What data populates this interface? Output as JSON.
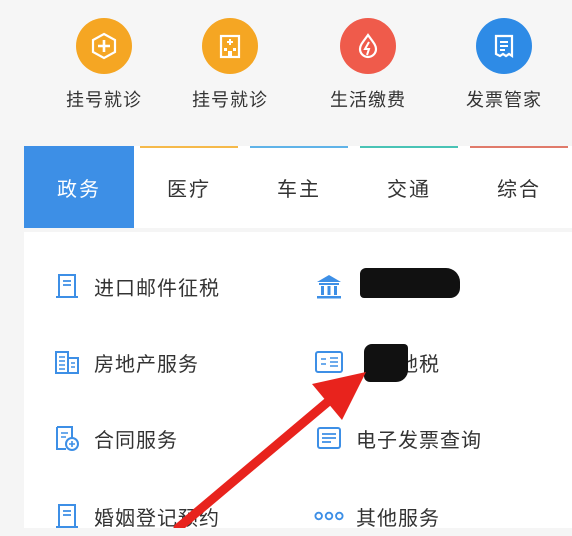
{
  "shortcuts": [
    {
      "label": "挂号就诊",
      "icon": "medical-cross-icon",
      "color": "#f5a623"
    },
    {
      "label": "挂号就诊",
      "icon": "hospital-building-icon",
      "color": "#f5a623"
    },
    {
      "label": "生活缴费",
      "icon": "utility-flame-icon",
      "color": "#ef5b4b"
    },
    {
      "label": "发票管家",
      "icon": "invoice-icon",
      "color": "#2e8be6"
    }
  ],
  "tabs": [
    {
      "label": "政务",
      "active": true,
      "accent": "#3d8fe6"
    },
    {
      "label": "医疗",
      "active": false,
      "accent": "#f5b94a"
    },
    {
      "label": "车主",
      "active": false,
      "accent": "#5fb3e8"
    },
    {
      "label": "交通",
      "active": false,
      "accent": "#49c3b5"
    },
    {
      "label": "综合",
      "active": false,
      "accent": "#e07a6a"
    }
  ],
  "services": {
    "left": [
      {
        "label": "进口邮件征税",
        "icon": "document-icon"
      },
      {
        "label": "房地产服务",
        "icon": "building-icon"
      },
      {
        "label": "合同服务",
        "icon": "contract-icon"
      },
      {
        "label": "婚姻登记预约",
        "icon": "document-icon"
      }
    ],
    "right": [
      {
        "label": "",
        "icon": "bank-icon"
      },
      {
        "label": "地税",
        "icon": "tax-card-icon"
      },
      {
        "label": "电子发票查询",
        "icon": "invoice-icon"
      },
      {
        "label": "其他服务",
        "icon": "more-dots-icon"
      }
    ]
  },
  "colors": {
    "primary": "#3d8fe6",
    "annotation_arrow": "#e8231d"
  }
}
